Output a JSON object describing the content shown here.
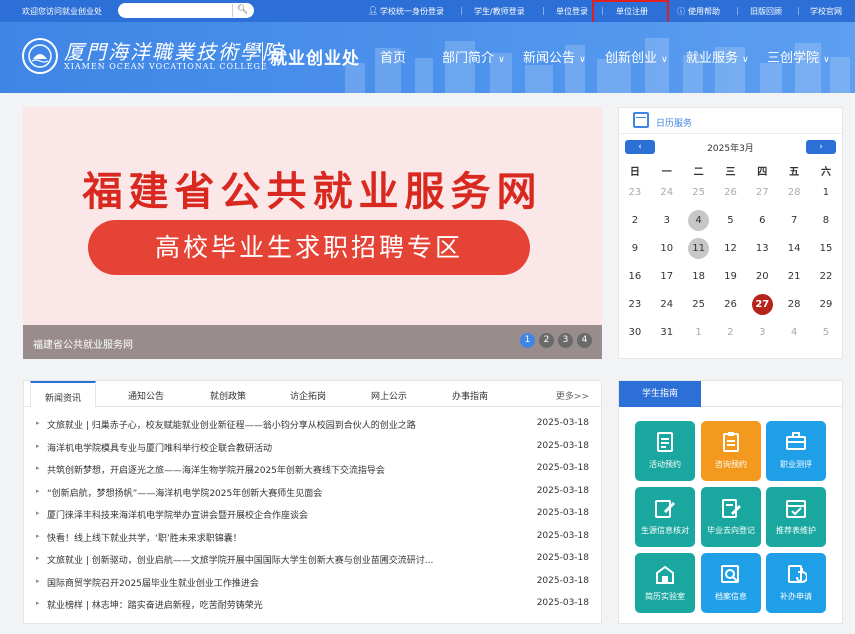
{
  "topbar": {
    "welcome": "欢迎您访问就业创业处",
    "search_placeholder": "",
    "search_icon": "search-icon",
    "links": [
      "学校统一身份登录",
      "学生/教师登录",
      "单位登录",
      "单位注册",
      "使用帮助",
      "旧版回顾",
      "学校官网"
    ],
    "highlighted": "单位注册"
  },
  "header": {
    "logo_icon": "school-emblem-icon",
    "school_cn": "厦門海洋職業技術學院",
    "school_en": "XIAMEN OCEAN VOCATIONAL COLLEGE",
    "department": "就业创业处",
    "nav": [
      "首页",
      "部门简介",
      "新闻公告",
      "创新创业",
      "就业服务",
      "三创学院"
    ]
  },
  "banner": {
    "title": "福建省公共就业服务网",
    "subtitle": "高校毕业生求职招聘专区",
    "caption": "福建省公共就业服务网",
    "dots": [
      "1",
      "2",
      "3",
      "4"
    ],
    "active_dot": 0
  },
  "calendar": {
    "title": "日历服务",
    "prev": "‹",
    "next": "›",
    "month": "2025年3月",
    "weekdays": [
      "日",
      "一",
      "二",
      "三",
      "四",
      "五",
      "六"
    ],
    "weeks": [
      [
        [
          "23",
          1
        ],
        [
          "24",
          1
        ],
        [
          "25",
          1
        ],
        [
          "26",
          1
        ],
        [
          "27",
          1
        ],
        [
          "28",
          1
        ],
        [
          "1",
          0
        ]
      ],
      [
        [
          "2",
          0
        ],
        [
          "3",
          0
        ],
        [
          "4",
          2
        ],
        [
          "5",
          0
        ],
        [
          "6",
          0
        ],
        [
          "7",
          0
        ],
        [
          "8",
          0
        ]
      ],
      [
        [
          "9",
          0
        ],
        [
          "10",
          0
        ],
        [
          "11",
          2
        ],
        [
          "12",
          0
        ],
        [
          "13",
          0
        ],
        [
          "14",
          0
        ],
        [
          "15",
          0
        ]
      ],
      [
        [
          "16",
          0
        ],
        [
          "17",
          0
        ],
        [
          "18",
          0
        ],
        [
          "19",
          0
        ],
        [
          "20",
          0
        ],
        [
          "21",
          0
        ],
        [
          "22",
          0
        ]
      ],
      [
        [
          "23",
          0
        ],
        [
          "24",
          0
        ],
        [
          "25",
          0
        ],
        [
          "26",
          0
        ],
        [
          "27",
          3
        ],
        [
          "28",
          0
        ],
        [
          "29",
          0
        ]
      ],
      [
        [
          "30",
          0
        ],
        [
          "31",
          0
        ],
        [
          "1",
          1
        ],
        [
          "2",
          1
        ],
        [
          "3",
          1
        ],
        [
          "4",
          1
        ],
        [
          "5",
          1
        ]
      ]
    ]
  },
  "news": {
    "tabs": [
      "新闻资讯",
      "通知公告",
      "就创政策",
      "访企拓岗",
      "网上公示",
      "办事指南"
    ],
    "active_tab": 0,
    "more": "更多>>",
    "items": [
      {
        "title": "文旅就业 | 归巢赤子心，校友赋能就业创业新征程——翁小钧分享从校园到合伙人的创业之路",
        "date": "2025-03-18"
      },
      {
        "title": "海洋机电学院模具专业与厦门唯科举行校企联合教研活动",
        "date": "2025-03-18"
      },
      {
        "title": "共筑创新梦想，开启逐光之旅——海洋生物学院开展2025年创新大赛线下交流指导会",
        "date": "2025-03-18"
      },
      {
        "title": "“创新启航，梦想扬帆”——海洋机电学院2025年创新大赛师生见面会",
        "date": "2025-03-18"
      },
      {
        "title": "厦门徕泽丰科技来海洋机电学院举办宣讲会暨开展校企合作座谈会",
        "date": "2025-03-18"
      },
      {
        "title": "快看！线上线下就业共学，‘职’胜未来求职锦囊！",
        "date": "2025-03-18"
      },
      {
        "title": "文旅就业 | 创新驱动，创业启航——文旅学院开展中国国际大学生创新大赛与创业苗圃交流研讨...",
        "date": "2025-03-18"
      },
      {
        "title": "国际商贸学院召开2025届毕业生就业创业工作推进会",
        "date": "2025-03-18"
      },
      {
        "title": "就业榜样 | 林志坤：踏实奋进启新程，吃苦耐劳铸荣光",
        "date": "2025-03-18"
      }
    ]
  },
  "guide": {
    "title": "学生指南",
    "tiles": [
      {
        "label": "活动预约",
        "icon": "document-icon",
        "color": "#1aa7a0"
      },
      {
        "label": "咨询预约",
        "icon": "clipboard-icon",
        "color": "#f39a1e"
      },
      {
        "label": "职业测评",
        "icon": "briefcase-icon",
        "color": "#1e9fe8"
      },
      {
        "label": "生源信息核对",
        "icon": "edit-form-icon",
        "color": "#1aa7a0"
      },
      {
        "label": "毕业去向登记",
        "icon": "edit-note-icon",
        "color": "#1aa7a0"
      },
      {
        "label": "推荐表维护",
        "icon": "calendar-check-icon",
        "color": "#1aa7a0"
      },
      {
        "label": "简历实验室",
        "icon": "building-icon",
        "color": "#1aa7a0"
      },
      {
        "label": "档案信息",
        "icon": "search-doc-icon",
        "color": "#1e9fe8"
      },
      {
        "label": "补办申请",
        "icon": "refresh-doc-icon",
        "color": "#1e9fe8"
      }
    ]
  }
}
